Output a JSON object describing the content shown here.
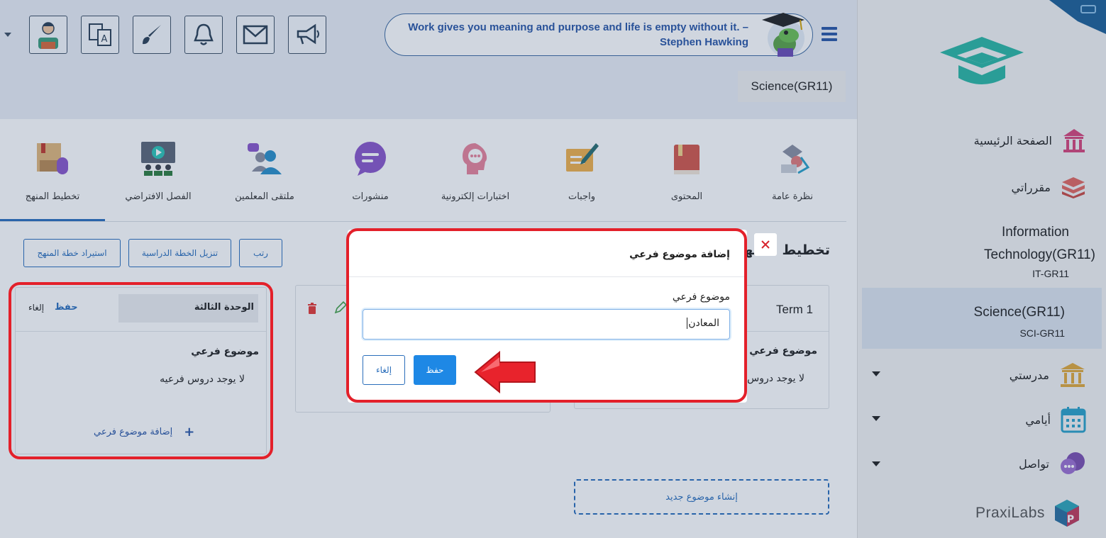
{
  "header": {
    "quote": "Work gives you meaning and purpose and life is empty without it. – Stephen Hawking",
    "course_badge": "Science(GR11)",
    "icons": [
      "megaphone-icon",
      "mail-icon",
      "bell-icon",
      "brush-icon",
      "translate-icon",
      "profile-icon"
    ]
  },
  "tabs": [
    {
      "label": "نظرة عامة",
      "icon": "overview-icon"
    },
    {
      "label": "المحتوى",
      "icon": "book-icon"
    },
    {
      "label": "واجبات",
      "icon": "assignment-icon"
    },
    {
      "label": "اختبارات إلكترونية",
      "icon": "quiz-icon"
    },
    {
      "label": "منشورات",
      "icon": "posts-icon"
    },
    {
      "label": "ملتقى المعلمين",
      "icon": "teachers-icon"
    },
    {
      "label": "الفصل الافتراضي",
      "icon": "virtual-class-icon"
    },
    {
      "label": "تخطيط المنهج",
      "icon": "curriculum-icon"
    }
  ],
  "toolbar": {
    "sort": "رتب",
    "download_plan": "تنزيل الخطة الدراسية",
    "import_plan": "استيراد خطة المنهج",
    "page_title": "تخطيط المنهج"
  },
  "unit_card": {
    "title_value": "الوحدة الثالثة",
    "save": "حفظ",
    "cancel": "إلغاء",
    "subtopic_heading": "موضوع فرعي",
    "empty_text": "لا يوجد دروس فرعيه",
    "add_subtopic": "إضافة موضوع فرعي"
  },
  "term_card": {
    "title": "Term 1",
    "subtopic_heading": "موضوع فرعي",
    "empty_text": "لا يوجد دروس"
  },
  "create_topic": "إنشاء موضوع جديد",
  "sidebar": {
    "items": [
      {
        "label": "الصفحة الرئيسية"
      },
      {
        "label": "مقرراتي"
      },
      {
        "label": "مدرستي"
      },
      {
        "label": "أيامي"
      },
      {
        "label": "تواصل"
      }
    ],
    "courses": [
      {
        "name": "Information Technology(GR11)",
        "code": "IT-GR11"
      },
      {
        "name": "Science(GR11)",
        "code": "SCI-GR11"
      }
    ],
    "brand": "PraxiLabs"
  },
  "modal": {
    "title": "إضافة موضوع فرعي",
    "field_label": "موضوع فرعي",
    "field_value": "المعادن",
    "save": "حفظ",
    "cancel": "إلغاء"
  },
  "colors": {
    "accent": "#2a6ebb",
    "highlight": "#e3202a",
    "primary_button": "#1e88e5"
  }
}
